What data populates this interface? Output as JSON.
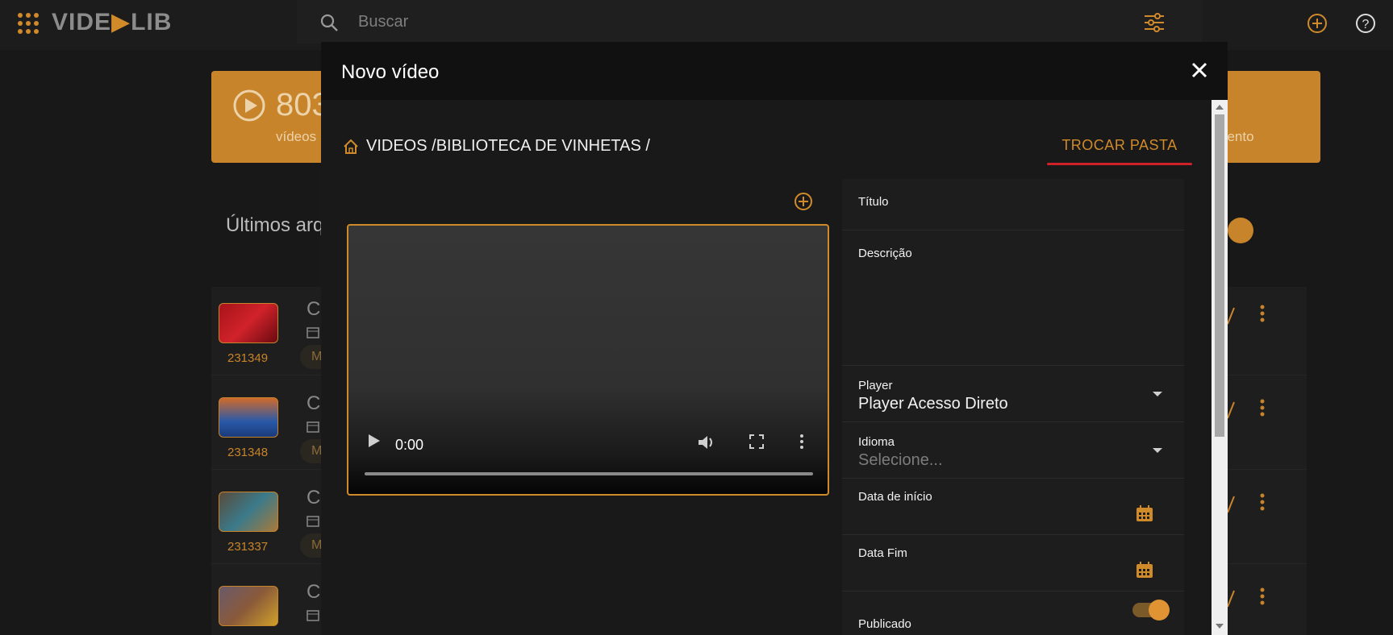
{
  "app": {
    "logo_text_before": "VIDE",
    "logo_text_after": "LIB",
    "accent": "#d08a2a"
  },
  "search": {
    "placeholder": "Buscar"
  },
  "background": {
    "stat_number": "803",
    "stat_label": "vídeos",
    "stat_right_label": "nento",
    "section_title": "Últimos arq",
    "rows": [
      {
        "id": "231349",
        "initial": "C",
        "chip": "M"
      },
      {
        "id": "231348",
        "initial": "C",
        "chip": "M"
      },
      {
        "id": "231337",
        "initial": "C",
        "chip": "M"
      },
      {
        "id": "",
        "initial": "C",
        "chip": ""
      }
    ]
  },
  "modal": {
    "title": "Novo vídeo",
    "breadcrumb": "VIDEOS /BIBLIOTECA DE VINHETAS /",
    "change_folder": "TROCAR PASTA",
    "video": {
      "time": "0:00",
      "progress": 0
    },
    "form": {
      "title_label": "Título",
      "title_value": "",
      "description_label": "Descrição",
      "description_value": "",
      "player_label": "Player",
      "player_value": "Player Acesso Direto",
      "language_label": "Idioma",
      "language_placeholder": "Selecione...",
      "start_date_label": "Data de início",
      "end_date_label": "Data Fim",
      "published_label": "Publicado",
      "published_on": true
    }
  }
}
